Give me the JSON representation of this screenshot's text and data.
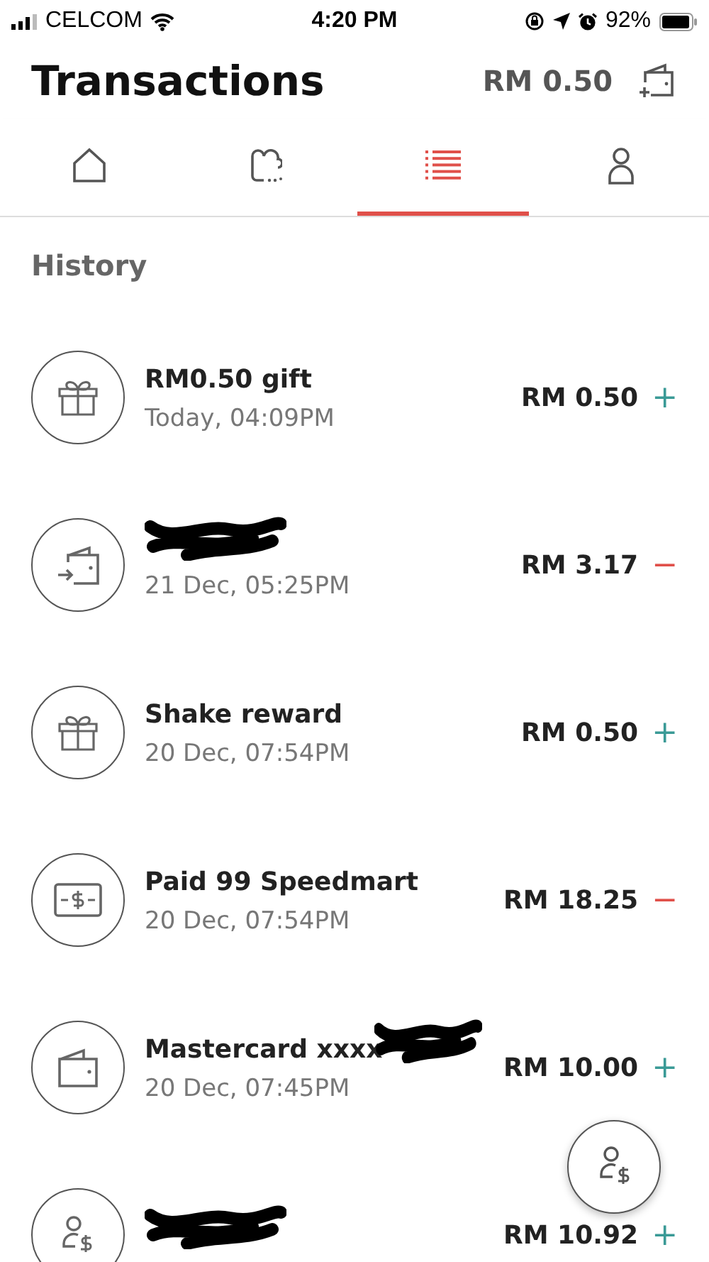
{
  "status_bar": {
    "carrier": "CELCOM",
    "time": "4:20 PM",
    "battery": "92%"
  },
  "header": {
    "title": "Transactions",
    "balance": "RM 0.50"
  },
  "tabs": [
    {
      "kind": "home",
      "selected": false
    },
    {
      "kind": "chat",
      "selected": false
    },
    {
      "kind": "list",
      "selected": true
    },
    {
      "kind": "person",
      "selected": false
    }
  ],
  "section": "History",
  "transactions": [
    {
      "kind": "gift",
      "title": "RM0.50 gift",
      "redacted": false,
      "date": "Today, 04:09PM",
      "amount": "RM 0.50",
      "sign": "+",
      "color": "#3a9a96"
    },
    {
      "kind": "transfer",
      "redacted": true,
      "date": "21 Dec, 05:25PM",
      "amount": "RM 3.17",
      "sign": "−",
      "color": "#e0504a"
    },
    {
      "kind": "gift",
      "title": "Shake reward",
      "redacted": false,
      "date": "20 Dec, 07:54PM",
      "amount": "RM 0.50",
      "sign": "+",
      "color": "#3a9a96"
    },
    {
      "kind": "cash",
      "title": "Paid 99 Speedmart",
      "redacted": false,
      "date": "20 Dec, 07:54PM",
      "amount": "RM 18.25",
      "sign": "−",
      "color": "#e0504a"
    },
    {
      "kind": "wallet",
      "title": "Mastercard xxxx",
      "redacted": true,
      "date": "20 Dec, 07:45PM",
      "amount": "RM 10.00",
      "sign": "+",
      "color": "#3a9a96"
    },
    {
      "kind": "person-dollar",
      "redacted": true,
      "amount": "RM 10.92",
      "sign": "+",
      "color": "#3a9a96"
    }
  ]
}
